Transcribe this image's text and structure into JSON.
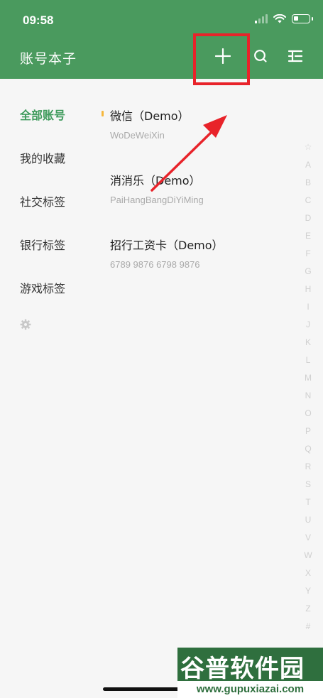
{
  "status_bar": {
    "time": "09:58"
  },
  "header": {
    "title": "账号本子",
    "add_icon": "plus-icon",
    "search_icon": "search-icon",
    "menu_icon": "list-menu-icon",
    "background_color": "#4a9a5e"
  },
  "sidebar": {
    "items": [
      {
        "label": "全部账号",
        "active": true
      },
      {
        "label": "我的收藏",
        "active": false
      },
      {
        "label": "社交标签",
        "active": false
      },
      {
        "label": "银行标签",
        "active": false
      },
      {
        "label": "游戏标签",
        "active": false
      }
    ],
    "settings_icon": "gear-icon",
    "active_color": "#3d9a5a"
  },
  "entries": [
    {
      "title": "微信（Demo）",
      "subtitle": "WoDeWeiXin"
    },
    {
      "title": "消消乐（Demo）",
      "subtitle": "PaiHangBangDiYiMing"
    },
    {
      "title": "招行工资卡（Demo）",
      "subtitle": "6789 9876 6798 9876"
    }
  ],
  "alphabet_index": [
    "☆",
    "A",
    "B",
    "C",
    "D",
    "E",
    "F",
    "G",
    "H",
    "I",
    "J",
    "K",
    "L",
    "M",
    "N",
    "O",
    "P",
    "Q",
    "R",
    "S",
    "T",
    "U",
    "V",
    "W",
    "X",
    "Y",
    "Z",
    "#"
  ],
  "watermark": {
    "main": "谷普软件园",
    "url": "www.gupuxiazai.com"
  },
  "annotation": {
    "highlight_color": "#e8232a"
  }
}
